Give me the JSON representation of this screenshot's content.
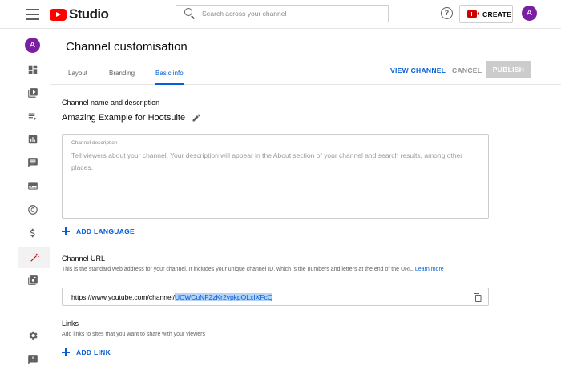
{
  "app": {
    "logo_text": "Studio",
    "brand_color": "#ff0000",
    "accent_color": "#065fd4"
  },
  "search": {
    "placeholder": "Search across your channel"
  },
  "header": {
    "help_icon": "question-circle-icon",
    "help_glyph": "?",
    "create_label": "CREATE",
    "avatar_letter": "A"
  },
  "sidebar": {
    "avatar_letter": "A",
    "items": [
      {
        "name": "dashboard",
        "icon": "dashboard-icon"
      },
      {
        "name": "content",
        "icon": "video-library-icon"
      },
      {
        "name": "playlists",
        "icon": "playlist-icon"
      },
      {
        "name": "analytics",
        "icon": "analytics-icon"
      },
      {
        "name": "comments",
        "icon": "comment-icon"
      },
      {
        "name": "subtitles",
        "icon": "subtitles-icon"
      },
      {
        "name": "copyright",
        "icon": "copyright-icon"
      },
      {
        "name": "earn",
        "icon": "dollar-icon"
      },
      {
        "name": "customisation",
        "icon": "magic-wand-icon",
        "active": true
      },
      {
        "name": "audio-library",
        "icon": "audio-library-icon"
      },
      {
        "name": "settings",
        "icon": "gear-icon"
      },
      {
        "name": "feedback",
        "icon": "feedback-icon"
      }
    ]
  },
  "page": {
    "title": "Channel customisation",
    "tabs": [
      {
        "label": "Layout"
      },
      {
        "label": "Branding"
      },
      {
        "label": "Basic info",
        "active": true
      }
    ],
    "view_channel_label": "VIEW CHANNEL",
    "cancel_label": "CANCEL",
    "publish_label": "PUBLISH"
  },
  "basic_info": {
    "name_section_title": "Channel name and description",
    "channel_name": "Amazing Example for Hootsuite",
    "description_label": "Channel description",
    "description_placeholder": "Tell viewers about your channel. Your description will appear in the About section of your channel and search results, among other places.",
    "add_language_label": "ADD LANGUAGE",
    "url_section_title": "Channel URL",
    "url_helper": "This is the standard web address for your channel. It includes your unique channel ID, which is the numbers and letters at the end of the URL.",
    "learn_more_label": "Learn more",
    "url_prefix": "https://www.youtube.com/channel/",
    "channel_id": "UCWCuNF2zKr2vpkpOLxIXFcQ",
    "links_section_title": "Links",
    "links_helper": "Add links to sites that you want to share with your viewers",
    "add_link_label": "ADD LINK"
  }
}
